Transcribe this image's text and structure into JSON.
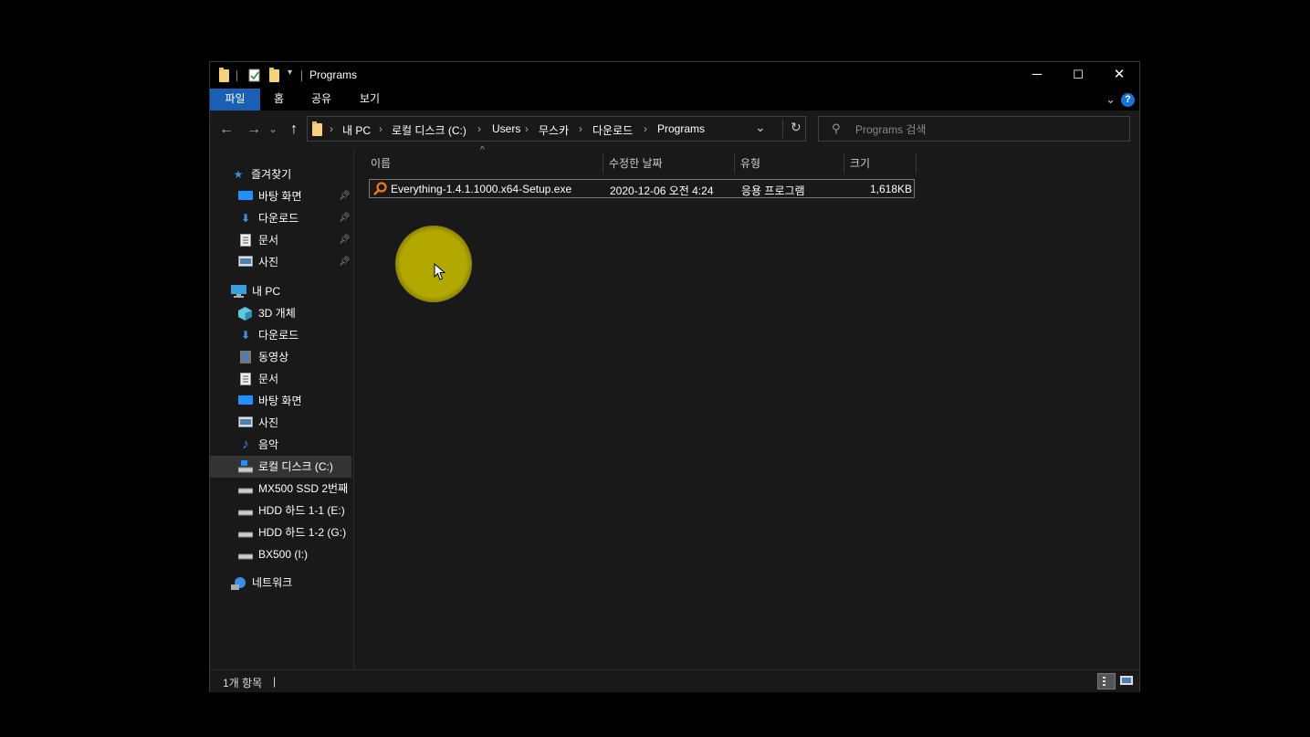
{
  "window": {
    "title": "Programs",
    "controls": {
      "minimize": "─",
      "maximize": "☐",
      "close": "✕"
    }
  },
  "ribbon": {
    "tabs": [
      "파일",
      "홈",
      "공유",
      "보기"
    ],
    "active_tab": "파일",
    "help": "?"
  },
  "nav": {
    "back": "←",
    "forward": "→",
    "recent": "⌄",
    "up": "↑",
    "breadcrumbs": [
      "내 PC",
      "로컬 디스크 (C:)",
      "Users",
      "무스카",
      "다운로드",
      "Programs"
    ],
    "dropdown": "⌄",
    "refresh": "↻"
  },
  "search": {
    "placeholder": "Programs 검색",
    "value": ""
  },
  "sidebar": {
    "quick_access": {
      "label": "즐겨찾기",
      "items": [
        "바탕 화면",
        "다운로드",
        "문서",
        "사진"
      ]
    },
    "this_pc": {
      "label": "내 PC",
      "items": [
        "3D 개체",
        "다운로드",
        "동영상",
        "문서",
        "바탕 화면",
        "사진",
        "음악",
        "로컬 디스크 (C:)",
        "MX500 SSD 2번째",
        "HDD 하드 1-1 (E:)",
        "HDD 하드 1-2 (G:)",
        "BX500 (I:)"
      ]
    },
    "network": {
      "label": "네트워크"
    },
    "selected": "로컬 디스크 (C:)"
  },
  "columns": [
    "이름",
    "수정한 날짜",
    "유형",
    "크기"
  ],
  "files": [
    {
      "name": "Everything-1.4.1.1000.x64-Setup.exe",
      "modified": "2020-12-06 오전 4:24",
      "type": "응용 프로그램",
      "size": "1,618KB"
    }
  ],
  "status": {
    "count": "1개 항목",
    "separator": "|"
  },
  "colors": {
    "window_bg": "#191919",
    "accent": "#1a5fb4",
    "cursor_highlight": "#b3a800"
  }
}
